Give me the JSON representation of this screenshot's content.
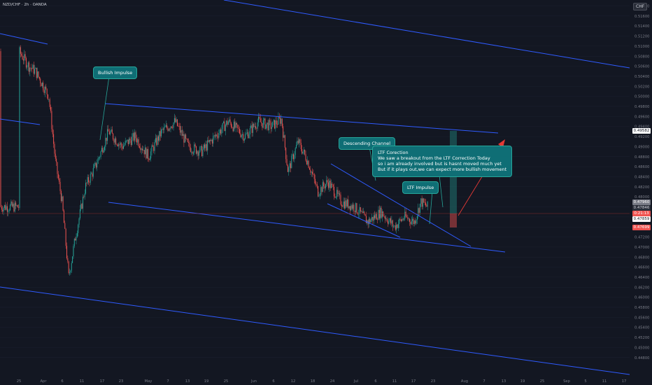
{
  "header": {
    "symbol": "NZD/CHF · 2h · OANDA",
    "currency": "CHF"
  },
  "colors": {
    "background": "#131722",
    "up": "#26a69a",
    "down": "#ef5350",
    "trendline": "#2f5bff",
    "callout_bg": "#0f6e75",
    "arrow": "#e53935",
    "axis_text": "#787b86"
  },
  "chart_data": {
    "type": "candlestick",
    "xlabel": "",
    "ylabel": "",
    "ylim": [
      0.448,
      0.5205
    ],
    "y_ticks": [
      "0.51800",
      "0.51600",
      "0.51400",
      "0.51200",
      "0.51000",
      "0.50800",
      "0.50600",
      "0.50400",
      "0.50200",
      "0.50000",
      "0.49800",
      "0.49600",
      "0.49400",
      "0.49200",
      "0.49000",
      "0.48800",
      "0.48600",
      "0.48400",
      "0.48200",
      "0.48000",
      "0.47800",
      "0.47600",
      "0.47400",
      "0.47200",
      "0.47000",
      "0.46800",
      "0.46600",
      "0.46400",
      "0.46200",
      "0.46000",
      "0.45800",
      "0.45600",
      "0.45400",
      "0.45200",
      "0.45000",
      "0.44800"
    ],
    "x_ticks": [
      "25",
      "Apr",
      "6",
      "11",
      "17",
      "23",
      "May",
      "7",
      "13",
      "19",
      "25",
      "Jun",
      "6",
      "12",
      "18",
      "24",
      "Jul",
      "6",
      "11",
      "17",
      "23",
      "Aug",
      "7",
      "13",
      "19",
      "25",
      "Sep",
      "5",
      "11",
      "17"
    ],
    "close_path_anchors": [
      {
        "t": "Mar 25",
        "price": 0.509
      },
      {
        "t": "Mar 28",
        "price": 0.506
      },
      {
        "t": "Mar 30",
        "price": 0.505
      },
      {
        "t": "Apr 3",
        "price": 0.5
      },
      {
        "t": "Apr 5",
        "price": 0.487
      },
      {
        "t": "Apr 7",
        "price": 0.479
      },
      {
        "t": "Apr 9",
        "price": 0.464
      },
      {
        "t": "Apr 11",
        "price": 0.472
      },
      {
        "t": "Apr 14",
        "price": 0.482
      },
      {
        "t": "Apr 17",
        "price": 0.486
      },
      {
        "t": "Apr 21",
        "price": 0.493
      },
      {
        "t": "Apr 25",
        "price": 0.49
      },
      {
        "t": "Apr 29",
        "price": 0.492
      },
      {
        "t": "May 3",
        "price": 0.488
      },
      {
        "t": "May 7",
        "price": 0.493
      },
      {
        "t": "May 11",
        "price": 0.495
      },
      {
        "t": "May 15",
        "price": 0.49
      },
      {
        "t": "May 19",
        "price": 0.489
      },
      {
        "t": "May 23",
        "price": 0.492
      },
      {
        "t": "May 27",
        "price": 0.495
      },
      {
        "t": "Jun 1",
        "price": 0.492
      },
      {
        "t": "Jun 5",
        "price": 0.495
      },
      {
        "t": "Jun 9",
        "price": 0.494
      },
      {
        "t": "Jun 12",
        "price": 0.4955
      },
      {
        "t": "Jun 14",
        "price": 0.485
      },
      {
        "t": "Jun 17",
        "price": 0.491
      },
      {
        "t": "Jun 20",
        "price": 0.487
      },
      {
        "t": "Jun 23",
        "price": 0.481
      },
      {
        "t": "Jun 26",
        "price": 0.483
      },
      {
        "t": "Jun 30",
        "price": 0.479
      },
      {
        "t": "Jul 4",
        "price": 0.478
      },
      {
        "t": "Jul 8",
        "price": 0.475
      },
      {
        "t": "Jul 12",
        "price": 0.477
      },
      {
        "t": "Jul 16",
        "price": 0.474
      },
      {
        "t": "Jul 19",
        "price": 0.476
      },
      {
        "t": "Jul 22",
        "price": 0.475
      },
      {
        "t": "Jul 24",
        "price": 0.479
      },
      {
        "t": "Jul 26",
        "price": 0.478
      }
    ],
    "annotations": [
      {
        "name": "bullish-impulse",
        "text": "Bullish Impulse"
      },
      {
        "name": "descending-channel",
        "text": "Descending Channel"
      },
      {
        "name": "ltf-correction",
        "text": "LTF Corection\nWe saw a breakout from the LTF Correction Today\nso i am already involved but is hasnt moved much yet\nBut if it plays out,we can expect more bullish movement"
      },
      {
        "name": "ltf-impulse",
        "text": "LTF Impulse"
      }
    ],
    "price_labels": {
      "resistance_level": "0.49582",
      "top_tag": "0.47960",
      "dark_tag": "0.47846",
      "countdown": "0:21:13",
      "last_price": "0.47859",
      "stop_tag": "0.47699"
    }
  }
}
